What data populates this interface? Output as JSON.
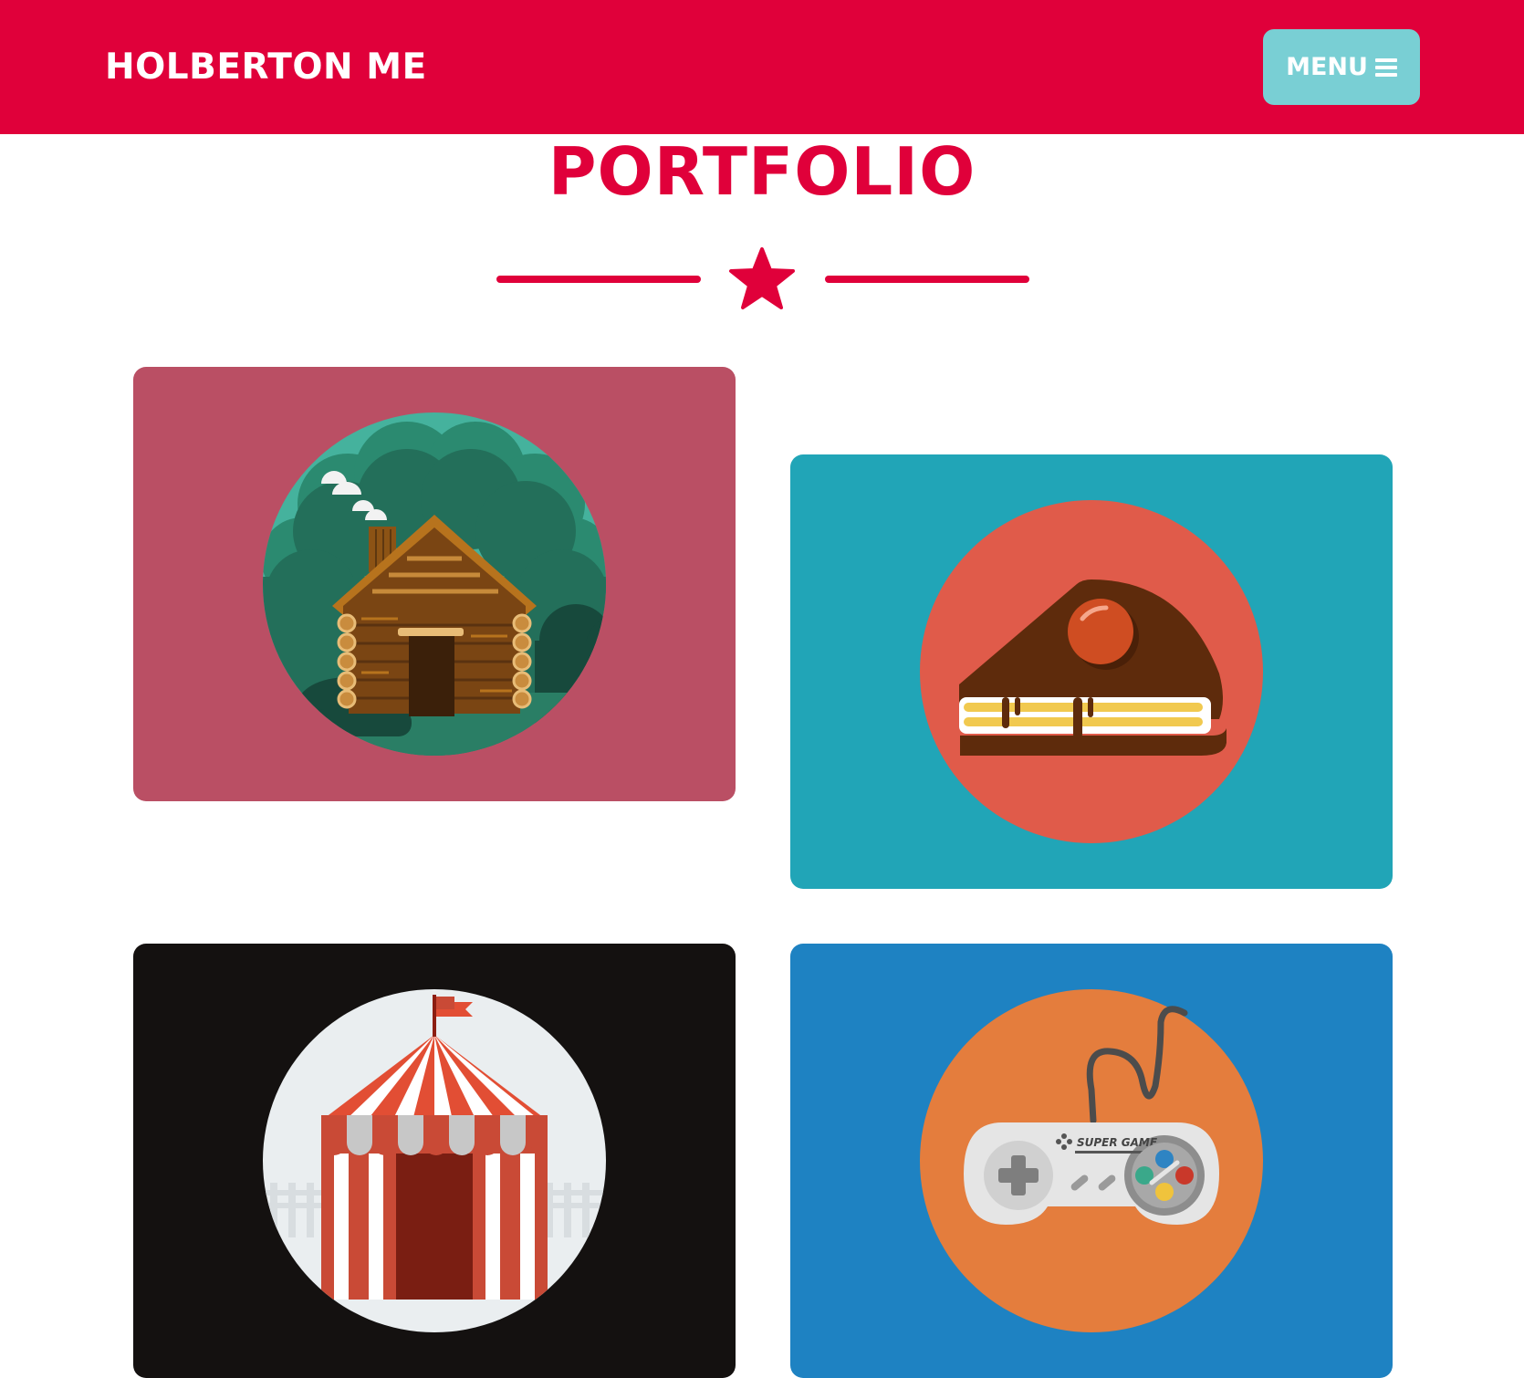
{
  "navbar": {
    "brand": "HOLBERTON ME",
    "menu_label": "MENU",
    "menu_icon": "hamburger-icon",
    "background": "#e0003a",
    "menu_background": "#79cfd4"
  },
  "portfolio": {
    "title": "PORTFOLIO",
    "divider_icon": "star-icon",
    "accent": "#e0003a",
    "items": [
      {
        "name": "log-cabin",
        "icon": "log-cabin-icon",
        "background": "#ba4f64",
        "circle": "#45b29d"
      },
      {
        "name": "cake-slice",
        "icon": "cake-slice-icon",
        "background": "#21a5b7",
        "circle": "#e05b4a"
      },
      {
        "name": "circus-tent",
        "icon": "circus-tent-icon",
        "background": "#141110",
        "circle": "#eaeef0"
      },
      {
        "name": "game-controller",
        "icon": "game-controller-icon",
        "background": "#1e82c2",
        "circle": "#e47d3d",
        "controller_text": "SUPER GAME"
      }
    ]
  }
}
